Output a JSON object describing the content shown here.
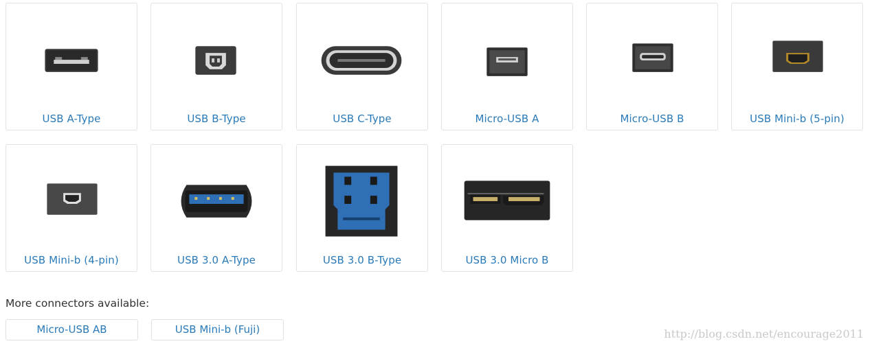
{
  "connectors": [
    {
      "label": "USB A-Type",
      "icon": "usb-a-connector-icon"
    },
    {
      "label": "USB B-Type",
      "icon": "usb-b-connector-icon"
    },
    {
      "label": "USB C-Type",
      "icon": "usb-c-connector-icon"
    },
    {
      "label": "Micro-USB A",
      "icon": "micro-usb-a-connector-icon"
    },
    {
      "label": "Micro-USB B",
      "icon": "micro-usb-b-connector-icon"
    },
    {
      "label": "USB Mini-b (5-pin)",
      "icon": "usb-mini-b-5pin-connector-icon"
    },
    {
      "label": "USB Mini-b (4-pin)",
      "icon": "usb-mini-b-4pin-connector-icon"
    },
    {
      "label": "USB 3.0 A-Type",
      "icon": "usb3-a-connector-icon"
    },
    {
      "label": "USB 3.0 B-Type",
      "icon": "usb3-b-connector-icon"
    },
    {
      "label": "USB 3.0 Micro B",
      "icon": "usb3-micro-b-connector-icon"
    }
  ],
  "more": {
    "heading": "More connectors available:",
    "items": [
      "Micro-USB AB",
      "USB Mini-b (Fuji)"
    ]
  },
  "watermark": "http://blog.csdn.net/encourage2011",
  "colors": {
    "link": "#2a7ab8",
    "border": "#e2e2e2",
    "usb3_blue": "#2f6fb5"
  }
}
